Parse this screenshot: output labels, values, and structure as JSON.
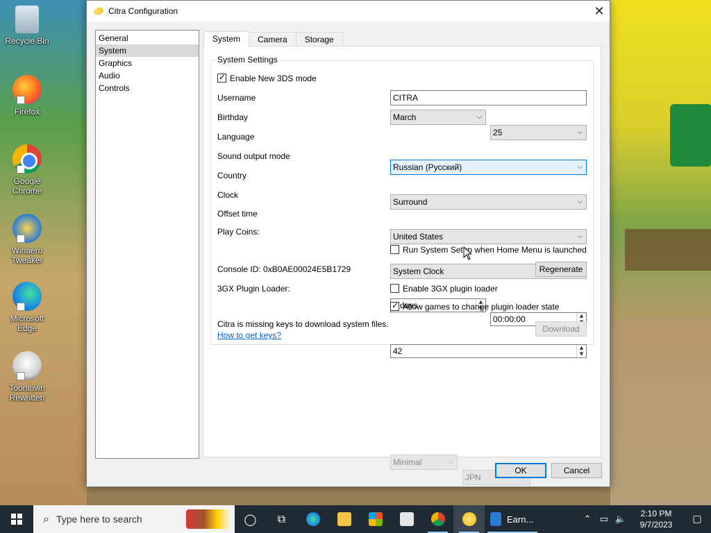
{
  "desktop": {
    "icons": [
      {
        "label": "Recycle Bin",
        "icon": "recycle-bin-icon"
      },
      {
        "label": "Firefox",
        "icon": "firefox-icon"
      },
      {
        "label": "Google Chrome",
        "icon": "chrome-icon"
      },
      {
        "label": "Winaero Tweaker",
        "icon": "winaero-icon"
      },
      {
        "label": "Microsoft Edge",
        "icon": "edge-icon"
      },
      {
        "label": "Toontown Rewritten",
        "icon": "toontown-icon"
      }
    ]
  },
  "window": {
    "title": "Citra Configuration",
    "close_glyph": "✕",
    "sidebar": {
      "items": [
        {
          "label": "General",
          "selected": false
        },
        {
          "label": "System",
          "selected": true
        },
        {
          "label": "Graphics",
          "selected": false
        },
        {
          "label": "Audio",
          "selected": false
        },
        {
          "label": "Controls",
          "selected": false
        }
      ]
    },
    "tabs": [
      {
        "label": "System",
        "active": true
      },
      {
        "label": "Camera",
        "active": false
      },
      {
        "label": "Storage",
        "active": false
      }
    ],
    "system_settings": {
      "group_title": "System Settings",
      "enable_new_3ds": {
        "label": "Enable New 3DS mode",
        "checked": true
      },
      "username": {
        "label": "Username",
        "value": "CITRA"
      },
      "birthday": {
        "label": "Birthday",
        "month": "March",
        "day": "25"
      },
      "language": {
        "label": "Language",
        "value": "Russian (Русский)"
      },
      "sound_output": {
        "label": "Sound output mode",
        "value": "Surround"
      },
      "country": {
        "label": "Country",
        "value": "United States"
      },
      "clock": {
        "label": "Clock",
        "value": "System Clock"
      },
      "offset_time": {
        "label": "Offset time",
        "days": "0 days",
        "time": "00:00:00"
      },
      "play_coins": {
        "label": "Play Coins:",
        "value": "42"
      },
      "run_system_setup": {
        "label": "Run System Setup when Home Menu is launched",
        "checked": false
      },
      "console_id": {
        "label": "Console ID: 0xB0AE00024E5B1729",
        "button": "Regenerate"
      },
      "plugin_loader": {
        "label": "3GX Plugin Loader:",
        "enable": {
          "label": "Enable 3GX plugin loader",
          "checked": false
        },
        "allow_games": {
          "label": "Allow games to change plugin loader state",
          "checked": true
        }
      },
      "keys": {
        "message": "Citra is missing keys to download system files.",
        "link": "How to get keys?",
        "mode": "Minimal",
        "region": "JPN",
        "download_button": "Download"
      }
    },
    "footer": {
      "ok": "OK",
      "cancel": "Cancel"
    }
  },
  "taskbar": {
    "search_placeholder": "Type here to search",
    "app_label": "Earn...",
    "time": "2:10 PM",
    "date": "9/7/2023"
  },
  "colors": {
    "accent": "#0078d7",
    "link": "#0066cc",
    "taskbar": "#1f2a33"
  }
}
